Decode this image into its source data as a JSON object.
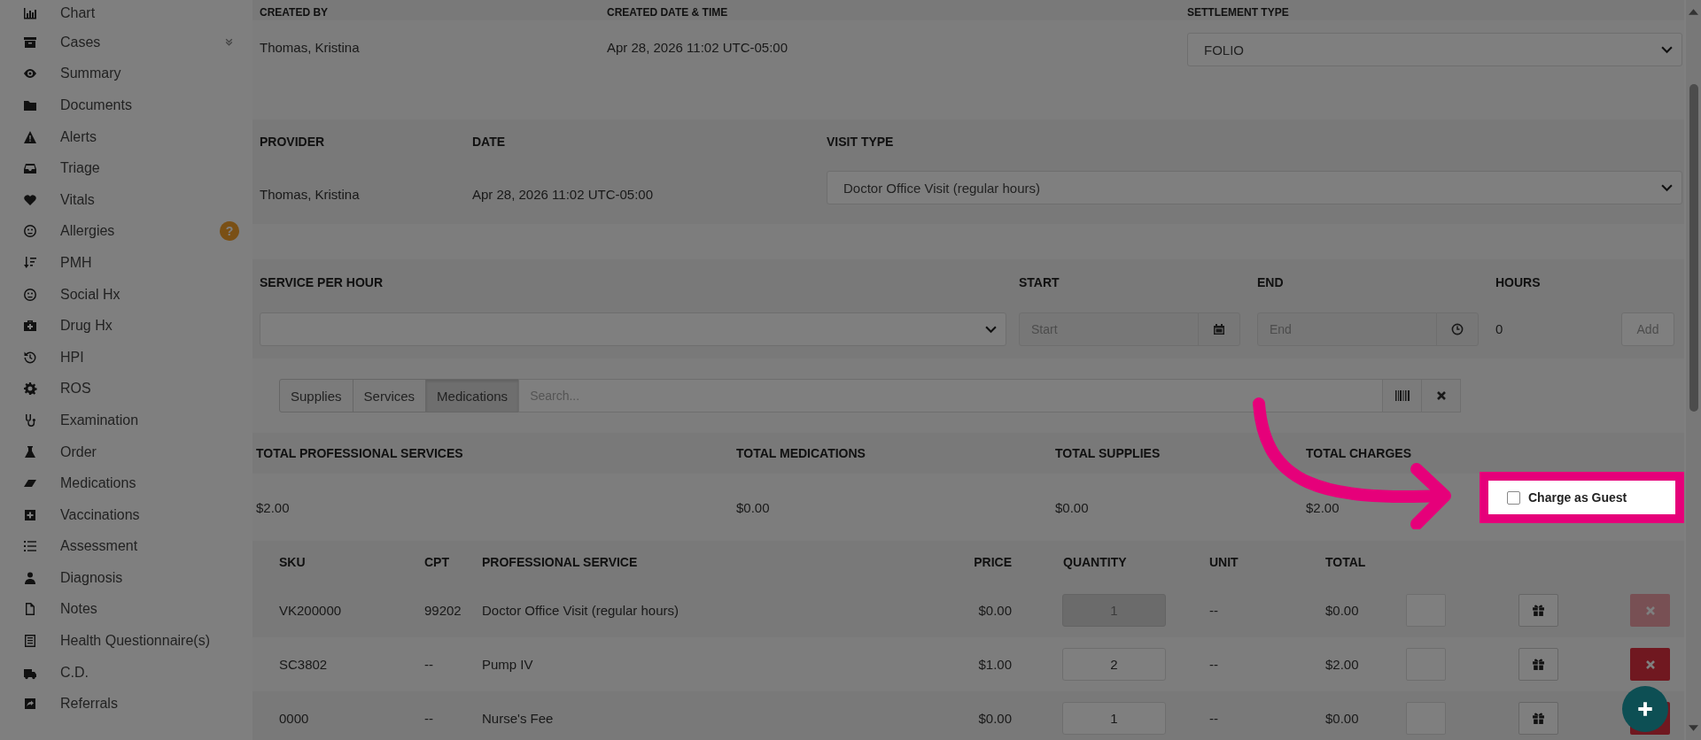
{
  "sidebar": {
    "items": [
      {
        "label": "Chart",
        "kind": "link"
      },
      {
        "label": "Cases",
        "kind": "group"
      },
      {
        "label": "Summary",
        "kind": "link"
      },
      {
        "label": "Documents",
        "kind": "link"
      },
      {
        "label": "Alerts",
        "kind": "link"
      },
      {
        "label": "Triage",
        "kind": "link"
      },
      {
        "label": "Vitals",
        "kind": "link"
      },
      {
        "label": "Allergies",
        "kind": "link",
        "badge": "?"
      },
      {
        "label": "PMH",
        "kind": "link"
      },
      {
        "label": "Social Hx",
        "kind": "link"
      },
      {
        "label": "Drug Hx",
        "kind": "link"
      },
      {
        "label": "HPI",
        "kind": "link"
      },
      {
        "label": "ROS",
        "kind": "link"
      },
      {
        "label": "Examination",
        "kind": "link"
      },
      {
        "label": "Order",
        "kind": "link"
      },
      {
        "label": "Medications",
        "kind": "link"
      },
      {
        "label": "Vaccinations",
        "kind": "link"
      },
      {
        "label": "Assessment",
        "kind": "link"
      },
      {
        "label": "Diagnosis",
        "kind": "link"
      },
      {
        "label": "Notes",
        "kind": "link"
      },
      {
        "label": "Health Questionnaire(s)",
        "kind": "link"
      },
      {
        "label": "C.D.",
        "kind": "link"
      },
      {
        "label": "Referrals",
        "kind": "link"
      }
    ]
  },
  "created": {
    "headers": [
      "CREATED BY",
      "CREATED DATE & TIME",
      "SETTLEMENT TYPE"
    ],
    "created_by": "Thomas, Kristina",
    "created_at": "Apr 28, 2026 11:02 UTC-05:00",
    "settlement_type": "FOLIO"
  },
  "visit": {
    "headers": [
      "PROVIDER",
      "DATE",
      "VISIT TYPE"
    ],
    "provider": "Thomas, Kristina",
    "date": "Apr 28, 2026 11:02 UTC-05:00",
    "visit_type": "Doctor Office Visit (regular hours)"
  },
  "service_per_hour": {
    "headers": [
      "SERVICE PER HOUR",
      "START",
      "END",
      "HOURS"
    ],
    "start_placeholder": "Start",
    "end_placeholder": "End",
    "hours": "0",
    "add_button": "Add"
  },
  "catalog": {
    "tabs": [
      {
        "label": "Supplies",
        "selected": false
      },
      {
        "label": "Services",
        "selected": false
      },
      {
        "label": "Medications",
        "selected": true
      }
    ],
    "search_placeholder": "Search..."
  },
  "totals": {
    "headers": [
      "TOTAL PROFESSIONAL SERVICES",
      "TOTAL MEDICATIONS",
      "TOTAL SUPPLIES",
      "TOTAL CHARGES"
    ],
    "values": [
      "$2.00",
      "$0.00",
      "$0.00",
      "$2.00"
    ]
  },
  "charge_as_guest": {
    "label": "Charge as Guest",
    "checked": false
  },
  "table": {
    "columns": [
      "SKU",
      "CPT",
      "PROFESSIONAL SERVICE",
      "PRICE",
      "QUANTITY",
      "UNIT",
      "TOTAL"
    ],
    "rows": [
      {
        "sku": "VK200000",
        "cpt": "99202",
        "service": "Doctor Office Visit (regular hours)",
        "price": "$0.00",
        "quantity": "1",
        "unit": "--",
        "total": "$0.00",
        "disabled": true
      },
      {
        "sku": "SC3802",
        "cpt": "--",
        "service": "Pump IV",
        "price": "$1.00",
        "quantity": "2",
        "unit": "--",
        "total": "$2.00",
        "disabled": false
      },
      {
        "sku": "0000",
        "cpt": "--",
        "service": "Nurse's Fee",
        "price": "$0.00",
        "quantity": "1",
        "unit": "--",
        "total": "$0.00",
        "disabled": false
      }
    ]
  }
}
